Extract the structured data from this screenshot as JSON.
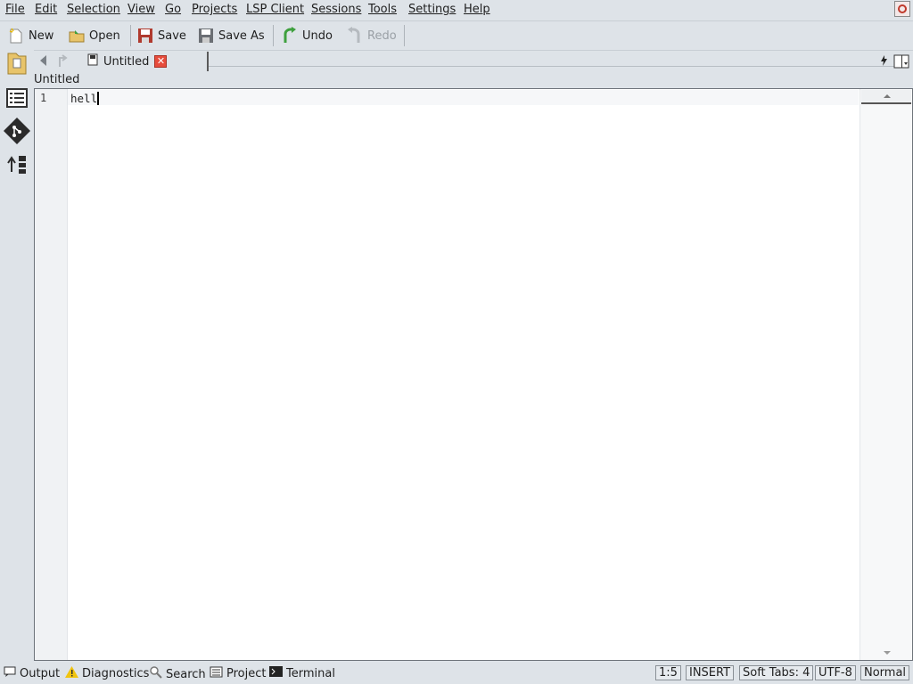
{
  "menu": [
    "File",
    "Edit",
    "Selection",
    "View",
    "Go",
    "Projects",
    "LSP Client",
    "Sessions",
    "Tools",
    "Settings",
    "Help"
  ],
  "toolbar": {
    "new": "New",
    "open": "Open",
    "save": "Save",
    "save_as": "Save As",
    "undo": "Undo",
    "redo": "Redo"
  },
  "tab": {
    "label": "Untitled",
    "close": "✕"
  },
  "document_title": "Untitled",
  "editor": {
    "line_number": "1",
    "text": "hell"
  },
  "panels": {
    "output": "Output",
    "diagnostics": "Diagnostics",
    "search": "Search",
    "project": "Project",
    "terminal": "Terminal"
  },
  "status": {
    "position": "1:5",
    "mode": "INSERT",
    "indent": "Soft Tabs: 4",
    "encoding": "UTF-8",
    "input_mode": "Normal"
  },
  "colors": {
    "background": "#dee3e8",
    "accent_green": "#3ea03e",
    "close_red": "#e74c3c",
    "disk_red": "#b03a2e"
  }
}
